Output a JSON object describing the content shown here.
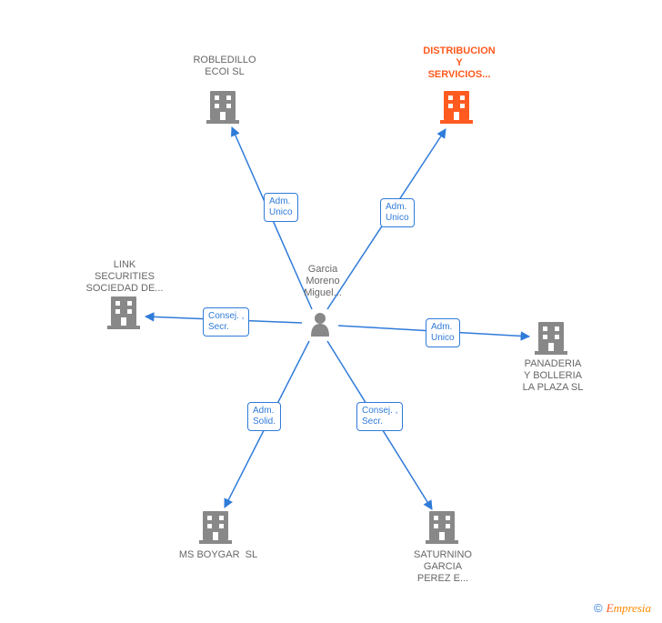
{
  "center": {
    "label": "Garcia\nMoreno\nMiguel..."
  },
  "nodes": [
    {
      "id": "robledillo",
      "label": "ROBLEDILLO\nECOI SL",
      "highlight": false
    },
    {
      "id": "distribucion",
      "label": "DISTRIBUCION\nY\nSERVICIOS...",
      "highlight": true
    },
    {
      "id": "link",
      "label": "LINK\nSECURITIES\nSOCIEDAD DE...",
      "highlight": false
    },
    {
      "id": "panaderia",
      "label": "PANADERIA\nY BOLLERIA\nLA PLAZA SL",
      "highlight": false
    },
    {
      "id": "msboygar",
      "label": "MS BOYGAR  SL",
      "highlight": false
    },
    {
      "id": "saturnino",
      "label": "SATURNINO\nGARCIA\nPEREZ E...",
      "highlight": false
    }
  ],
  "edges": [
    {
      "to": "robledillo",
      "role": "Adm.\nUnico"
    },
    {
      "to": "distribucion",
      "role": "Adm.\nUnico"
    },
    {
      "to": "link",
      "role": "Consej. ,\nSecr."
    },
    {
      "to": "panaderia",
      "role": "Adm.\nUnico"
    },
    {
      "to": "msboygar",
      "role": "Adm.\nSolid."
    },
    {
      "to": "saturnino",
      "role": "Consej. ,\nSecr."
    }
  ],
  "watermark": {
    "copyright": "©",
    "brand": "mpresia",
    "brand_initial": "E"
  },
  "colors": {
    "arrow": "#2f7bd9",
    "building_fill": "#888888",
    "building_highlight": "#ff5a1f",
    "person": "#888888"
  }
}
